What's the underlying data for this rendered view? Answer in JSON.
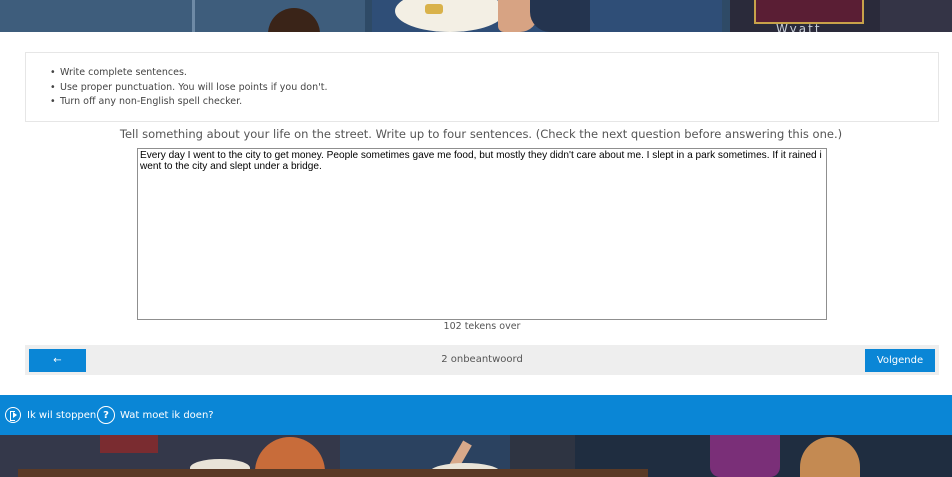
{
  "instructions": {
    "items": [
      "Write complete sentences.",
      "Use proper punctuation. You will lose points if you don't.",
      "Turn off any non-English spell checker."
    ]
  },
  "question": {
    "text": "Tell something about your life on the street. Write up to four sentences. (Check the next question before answering this one.)"
  },
  "answer": {
    "value": "Every day I went to the city to get money. People sometimes gave me food, but mostly they didn't care about me. I slept in a park sometimes. If it rained i went to the city and slept under a bridge."
  },
  "characters_left": "102 tekens over",
  "navigation": {
    "prev_label": "← Vorige",
    "status": "2 onbeantwoord",
    "next_label": "Volgende →"
  },
  "footer": {
    "stop_label": "Ik wil stoppen",
    "help_label": "Wat moet ik doen?",
    "help_icon_glyph": "?"
  },
  "illustration": {
    "top_sign_text": "Wyatt"
  },
  "colors": {
    "accent": "#0a86d6",
    "nav_background": "#eeeeee"
  }
}
